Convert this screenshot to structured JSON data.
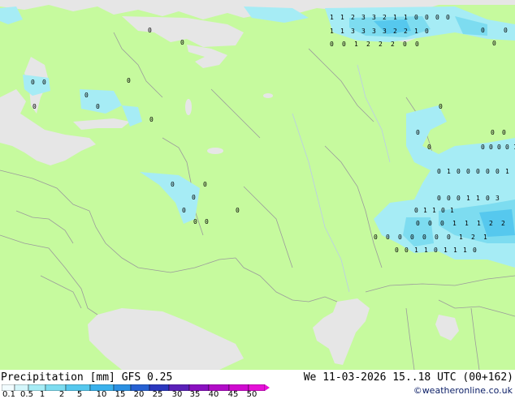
{
  "footer": {
    "legend_title": "Precipitation [mm]",
    "model": "GFS 0.25",
    "valid_time": "We 11-03-2026 15..18 UTC (00+162)",
    "credit": "©weatheronline.co.uk"
  },
  "legend": {
    "ticks": [
      "0.1",
      "0.5",
      "1",
      "2",
      "5",
      "10",
      "15",
      "20",
      "25",
      "30",
      "35",
      "40",
      "45",
      "50"
    ],
    "colors": [
      "#f2fcff",
      "#d4f6fb",
      "#a6ecf5",
      "#7ddcf0",
      "#56c8ee",
      "#3ab1ec",
      "#2b90e2",
      "#2660d2",
      "#2a37be",
      "#5a20b8",
      "#8a10c0",
      "#b20cc8",
      "#d00ad0",
      "#e610d8"
    ]
  },
  "colors": {
    "land": "#c6fa9e",
    "sea": "#e6e6e6",
    "precip_light": "#a6ecf5",
    "precip_mid": "#7ddcf0",
    "border": "#9b9b9b"
  },
  "labels": {
    "top_band_row1": [
      "1",
      "1",
      "2",
      "3",
      "3",
      "2",
      "1",
      "1",
      "0",
      "0",
      "0",
      "0"
    ],
    "top_band_row2": [
      "1",
      "1",
      "3",
      "3",
      "3",
      "3",
      "2",
      "2",
      "1",
      "0"
    ],
    "top_band_row3": [
      "0",
      "0",
      "1",
      "2",
      "2",
      "2",
      "0",
      "0"
    ],
    "east_a": [
      "0",
      "0",
      "0",
      "0",
      "1",
      "1"
    ],
    "east_b": [
      "0",
      "1",
      "0",
      "0",
      "0",
      "0",
      "0",
      "1"
    ],
    "east_c": [
      "0",
      "0",
      "0",
      "1",
      "1",
      "0",
      "3"
    ],
    "east_d": [
      "0",
      "0",
      "0",
      "1",
      "1",
      "1",
      "2",
      "2"
    ],
    "east_e": [
      "0",
      "0",
      "0",
      "0",
      "0",
      "0",
      "0",
      "1",
      "2",
      "1"
    ],
    "east_f": [
      "0",
      "0",
      "1",
      "1",
      "0",
      "1",
      "1",
      "1",
      "0"
    ],
    "east_g": [
      "0",
      "1",
      "1",
      "0",
      "1"
    ],
    "misc_zeros": [
      "0",
      "0",
      "0",
      "0",
      "0",
      "0",
      "0",
      "0",
      "0",
      "0",
      "0",
      "0",
      "0",
      "0",
      "0",
      "0",
      "0",
      "0",
      "0",
      "0",
      "0",
      "0",
      "0",
      "0"
    ]
  }
}
